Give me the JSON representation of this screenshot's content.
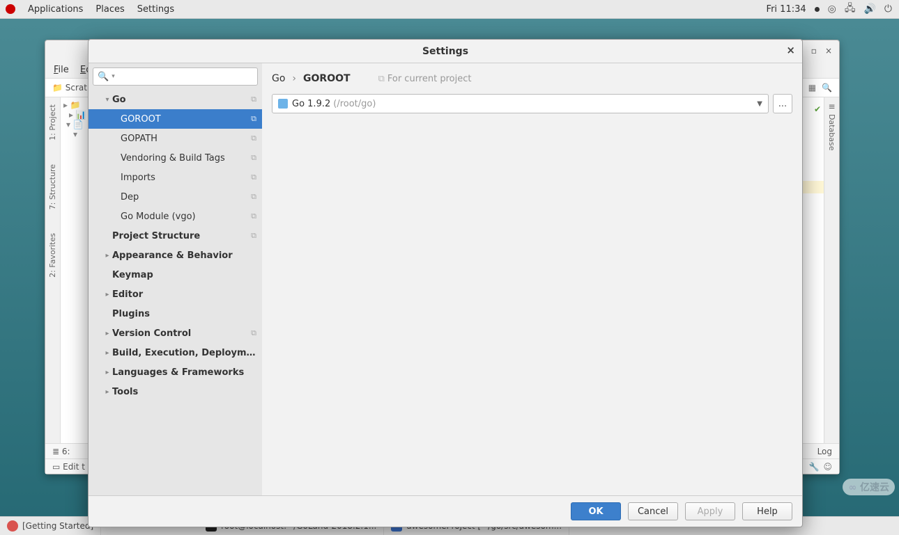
{
  "topbar": {
    "apps": "Applications",
    "places": "Places",
    "settings": "Settings",
    "clock": "Fri 11:34"
  },
  "ide": {
    "menu_file": "File",
    "menu_edit": "Edit",
    "crumb_folder": "Scrat",
    "left_project": "1: Project",
    "left_structure": "7: Structure",
    "left_favorites": "2: Favorites",
    "right_database": "Database",
    "status_left": "6:",
    "status_log": "Log",
    "status2_left": "Edit t"
  },
  "settings": {
    "title": "Settings",
    "search_placeholder": "",
    "tree": {
      "go": "Go",
      "goroot": "GOROOT",
      "gopath": "GOPATH",
      "vendoring": "Vendoring & Build Tags",
      "imports": "Imports",
      "dep": "Dep",
      "vgo": "Go Module (vgo)",
      "proj_struct": "Project Structure",
      "appearance": "Appearance & Behavior",
      "keymap": "Keymap",
      "editor": "Editor",
      "plugins": "Plugins",
      "vcs": "Version Control",
      "build": "Build, Execution, Deployment",
      "langs": "Languages & Frameworks",
      "tools": "Tools"
    },
    "crumb_root": "Go",
    "crumb_leaf": "GOROOT",
    "scope": "For current project",
    "sdk_label": "Go 1.9.2",
    "sdk_path": "(/root/go)",
    "browse": "...",
    "btn_ok": "OK",
    "btn_cancel": "Cancel",
    "btn_apply": "Apply",
    "btn_help": "Help"
  },
  "taskbar": {
    "t1": "[Getting Started]",
    "t2": "root@localhost:~/GoLand-2018.2.1...",
    "t3": "awesomeProject [~/go/src/awesom..."
  },
  "watermark": "亿速云"
}
